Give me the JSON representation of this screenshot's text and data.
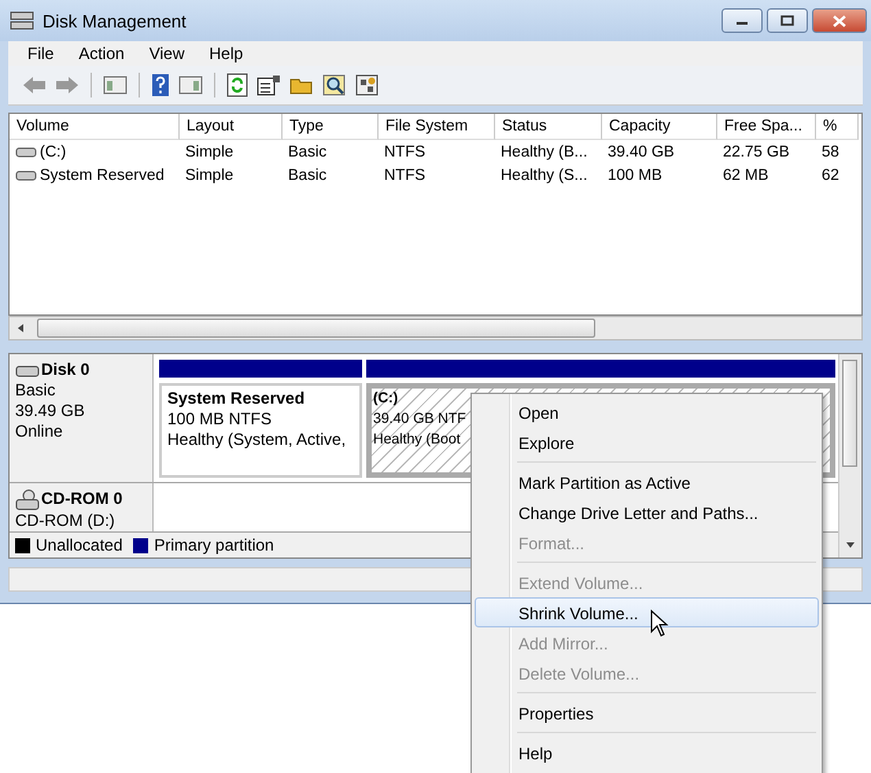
{
  "window": {
    "title": "Disk Management"
  },
  "menu": [
    {
      "label": "File"
    },
    {
      "label": "Action"
    },
    {
      "label": "View"
    },
    {
      "label": "Help"
    }
  ],
  "table": {
    "columns": [
      "Volume",
      "Layout",
      "Type",
      "File System",
      "Status",
      "Capacity",
      "Free Spa...",
      "%"
    ],
    "rows": [
      {
        "cells": [
          "(C:)",
          "Simple",
          "Basic",
          "NTFS",
          "Healthy (B...",
          "39.40 GB",
          "22.75 GB",
          "58"
        ]
      },
      {
        "cells": [
          "System Reserved",
          "Simple",
          "Basic",
          "NTFS",
          "Healthy (S...",
          "100 MB",
          "62 MB",
          "62"
        ]
      }
    ]
  },
  "disks": [
    {
      "kind": "disk",
      "name": "Disk 0",
      "lines": [
        "Basic",
        "39.49 GB",
        "Online"
      ],
      "partitions": [
        {
          "name": "System Reserved",
          "size": "100 MB NTFS",
          "status": "Healthy (System, Active,",
          "selected": false
        },
        {
          "name": "(C:)",
          "size": "39.40 GB NTF",
          "status": "Healthy (Boot",
          "selected": true
        }
      ]
    },
    {
      "kind": "cdrom",
      "name": "CD-ROM 0",
      "lines": [
        "CD-ROM (D:)"
      ]
    }
  ],
  "legend": [
    {
      "label": "Unallocated",
      "color": "#000000"
    },
    {
      "label": "Primary partition",
      "color": "#00008b"
    }
  ],
  "context_menu": [
    {
      "kind": "item",
      "label": "Open",
      "disabled": false,
      "selected": false
    },
    {
      "kind": "item",
      "label": "Explore",
      "disabled": false,
      "selected": false
    },
    {
      "kind": "separator"
    },
    {
      "kind": "item",
      "label": "Mark Partition as Active",
      "disabled": false,
      "selected": false
    },
    {
      "kind": "item",
      "label": "Change Drive Letter and Paths...",
      "disabled": false,
      "selected": false
    },
    {
      "kind": "item",
      "label": "Format...",
      "disabled": true,
      "selected": false
    },
    {
      "kind": "separator"
    },
    {
      "kind": "item",
      "label": "Extend Volume...",
      "disabled": true,
      "selected": false
    },
    {
      "kind": "item",
      "label": "Shrink Volume...",
      "disabled": false,
      "selected": true
    },
    {
      "kind": "item",
      "label": "Add Mirror...",
      "disabled": true,
      "selected": false
    },
    {
      "kind": "item",
      "label": "Delete Volume...",
      "disabled": true,
      "selected": false
    },
    {
      "kind": "separator"
    },
    {
      "kind": "item",
      "label": "Properties",
      "disabled": false,
      "selected": false
    },
    {
      "kind": "separator"
    },
    {
      "kind": "item",
      "label": "Help",
      "disabled": false,
      "selected": false
    }
  ]
}
